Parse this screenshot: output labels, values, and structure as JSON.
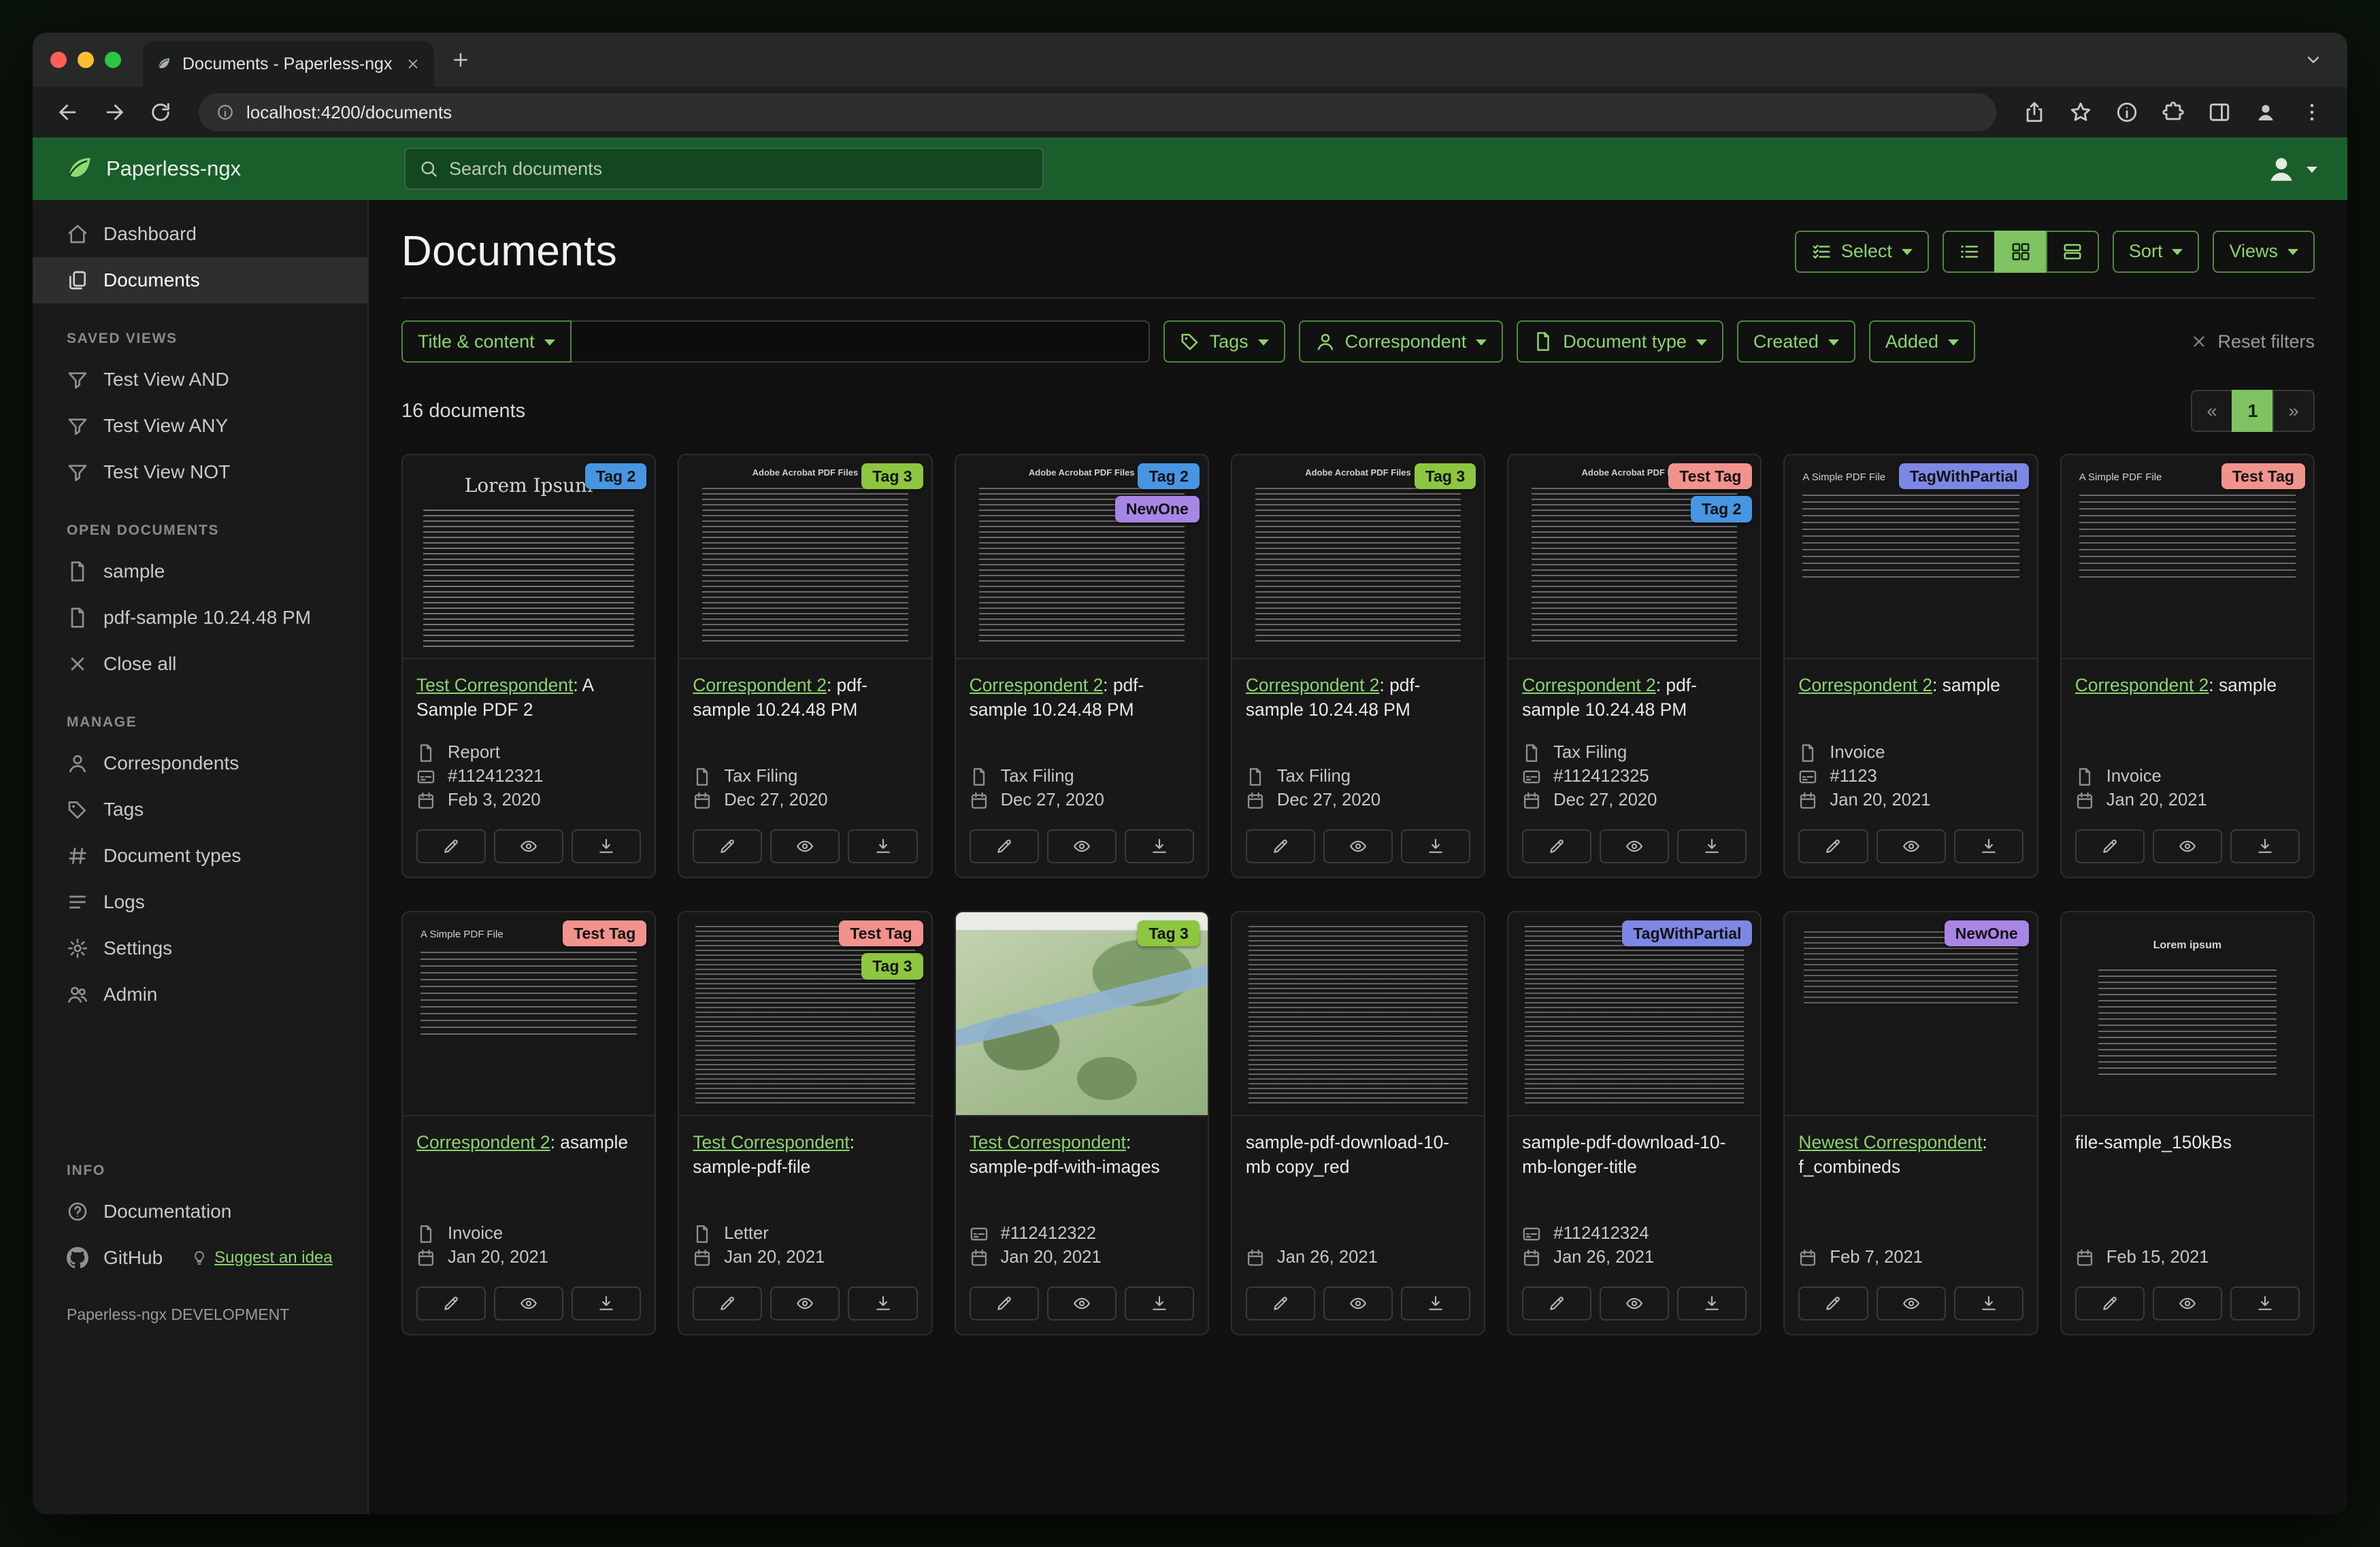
{
  "browser": {
    "tab": {
      "title": "Documents - Paperless-ngx"
    },
    "url": "localhost:4200/documents"
  },
  "app_header": {
    "brand": "Paperless-ngx",
    "search_placeholder": "Search documents"
  },
  "sidebar": {
    "groups": [
      {
        "label": "",
        "items": [
          {
            "label": "Dashboard",
            "icon": "dashboard",
            "active": false
          },
          {
            "label": "Documents",
            "icon": "documents",
            "active": true
          }
        ]
      },
      {
        "label": "SAVED VIEWS",
        "items": [
          {
            "label": "Test View AND",
            "icon": "filter"
          },
          {
            "label": "Test View ANY",
            "icon": "filter"
          },
          {
            "label": "Test View NOT",
            "icon": "filter"
          }
        ]
      },
      {
        "label": "OPEN DOCUMENTS",
        "items": [
          {
            "label": "sample",
            "icon": "file"
          },
          {
            "label": "pdf-sample 10.24.48 PM",
            "icon": "file"
          },
          {
            "label": "Close all",
            "icon": "close"
          }
        ]
      },
      {
        "label": "MANAGE",
        "items": [
          {
            "label": "Correspondents",
            "icon": "person"
          },
          {
            "label": "Tags",
            "icon": "tag"
          },
          {
            "label": "Document types",
            "icon": "hash"
          },
          {
            "label": "Logs",
            "icon": "logs"
          },
          {
            "label": "Settings",
            "icon": "gear"
          },
          {
            "label": "Admin",
            "icon": "admin"
          }
        ]
      },
      {
        "label": "INFO",
        "items": [
          {
            "label": "Documentation",
            "icon": "question"
          },
          {
            "label": "GitHub",
            "icon": "github",
            "extra": "Suggest an idea"
          }
        ]
      }
    ],
    "footer": "Paperless-ngx DEVELOPMENT"
  },
  "main": {
    "title": "Documents",
    "toolbar": {
      "select": "Select",
      "sort": "Sort",
      "views": "Views"
    },
    "filters": {
      "title_content": "Title & content",
      "chips": [
        {
          "label": "Tags",
          "icon": "tag"
        },
        {
          "label": "Correspondent",
          "icon": "person"
        },
        {
          "label": "Document type",
          "icon": "file"
        },
        {
          "label": "Created",
          "icon": ""
        },
        {
          "label": "Added",
          "icon": ""
        }
      ],
      "reset": "Reset filters"
    },
    "count": "16 documents",
    "pagination": {
      "prev": "«",
      "page": "1",
      "next": "»"
    }
  },
  "tag_colors": {
    "Tag 2": "#4796e3",
    "Tag 3": "#8dc63f",
    "NewOne": "#a886e6",
    "Test Tag": "#f2928c",
    "TagWithPartial": "#7d87e5"
  },
  "documents": [
    {
      "tags": [
        "Tag 2"
      ],
      "correspondent": "Test Correspondent",
      "title": ": A Sample PDF 2",
      "type": "Report",
      "asn": "#112412321",
      "created": "Feb 3, 2020",
      "thumb": {
        "kind": "serif",
        "heading": "Lorem Ipsum"
      }
    },
    {
      "tags": [
        "Tag 3"
      ],
      "correspondent": "Correspondent 2",
      "title": ": pdf-sample 10.24.48 PM",
      "type": "Tax Filing",
      "asn": "",
      "created": "Dec 27, 2020",
      "thumb": {
        "kind": "acrobat",
        "heading": "Adobe Acrobat PDF Files"
      }
    },
    {
      "tags": [
        "Tag 2",
        "NewOne"
      ],
      "correspondent": "Correspondent 2",
      "title": ": pdf-sample 10.24.48 PM",
      "type": "Tax Filing",
      "asn": "",
      "created": "Dec 27, 2020",
      "thumb": {
        "kind": "acrobat",
        "heading": "Adobe Acrobat PDF Files"
      }
    },
    {
      "tags": [
        "Tag 3"
      ],
      "correspondent": "Correspondent 2",
      "title": ": pdf-sample 10.24.48 PM",
      "type": "Tax Filing",
      "asn": "",
      "created": "Dec 27, 2020",
      "thumb": {
        "kind": "acrobat",
        "heading": "Adobe Acrobat PDF Files"
      }
    },
    {
      "tags": [
        "Test Tag",
        "Tag 2"
      ],
      "correspondent": "Correspondent 2",
      "title": ": pdf-sample 10.24.48 PM",
      "type": "Tax Filing",
      "asn": "#112412325",
      "created": "Dec 27, 2020",
      "thumb": {
        "kind": "acrobat",
        "heading": "Adobe Acrobat PDF Files"
      }
    },
    {
      "tags": [
        "TagWithPartial"
      ],
      "correspondent": "Correspondent 2",
      "title": ": sample",
      "type": "Invoice",
      "asn": "#1123",
      "created": "Jan 20, 2021",
      "thumb": {
        "kind": "simple",
        "heading": "A Simple PDF File"
      }
    },
    {
      "tags": [
        "Test Tag"
      ],
      "correspondent": "Correspondent 2",
      "title": ": sample",
      "type": "Invoice",
      "asn": "",
      "created": "Jan 20, 2021",
      "thumb": {
        "kind": "simple",
        "heading": "A Simple PDF File"
      }
    },
    {
      "tags": [
        "Test Tag"
      ],
      "correspondent": "Correspondent 2",
      "title": ": asample",
      "type": "Invoice",
      "asn": "",
      "created": "Jan 20, 2021",
      "thumb": {
        "kind": "simple",
        "heading": "A Simple PDF File"
      }
    },
    {
      "tags": [
        "Test Tag",
        "Tag 3"
      ],
      "correspondent": "Test Correspondent",
      "title": ": sample-pdf-file",
      "type": "Letter",
      "asn": "",
      "created": "Jan 20, 2021",
      "thumb": {
        "kind": "dense",
        "heading": ""
      }
    },
    {
      "tags": [
        "Tag 3"
      ],
      "correspondent": "Test Correspondent",
      "title": ": sample-pdf-with-images",
      "type": "",
      "asn": "#112412322",
      "created": "Jan 20, 2021",
      "thumb": {
        "kind": "map",
        "heading": ""
      }
    },
    {
      "tags": [],
      "correspondent": "",
      "title": "sample-pdf-download-10-mb copy_red",
      "type": "",
      "asn": "",
      "created": "Jan 26, 2021",
      "thumb": {
        "kind": "dense",
        "heading": ""
      }
    },
    {
      "tags": [
        "TagWithPartial"
      ],
      "correspondent": "",
      "title": "sample-pdf-download-10-mb-longer-title",
      "type": "",
      "asn": "#112412324",
      "created": "Jan 26, 2021",
      "thumb": {
        "kind": "dense",
        "heading": ""
      }
    },
    {
      "tags": [
        "NewOne"
      ],
      "correspondent": "Newest Correspondent",
      "title": ": f_combineds",
      "type": "",
      "asn": "",
      "created": "Feb 7, 2021",
      "thumb": {
        "kind": "sparse",
        "heading": ""
      }
    },
    {
      "tags": [],
      "correspondent": "",
      "title": "file-sample_150kBs",
      "type": "",
      "asn": "",
      "created": "Feb 15, 2021",
      "thumb": {
        "kind": "center",
        "heading": "Lorem ipsum"
      }
    }
  ]
}
